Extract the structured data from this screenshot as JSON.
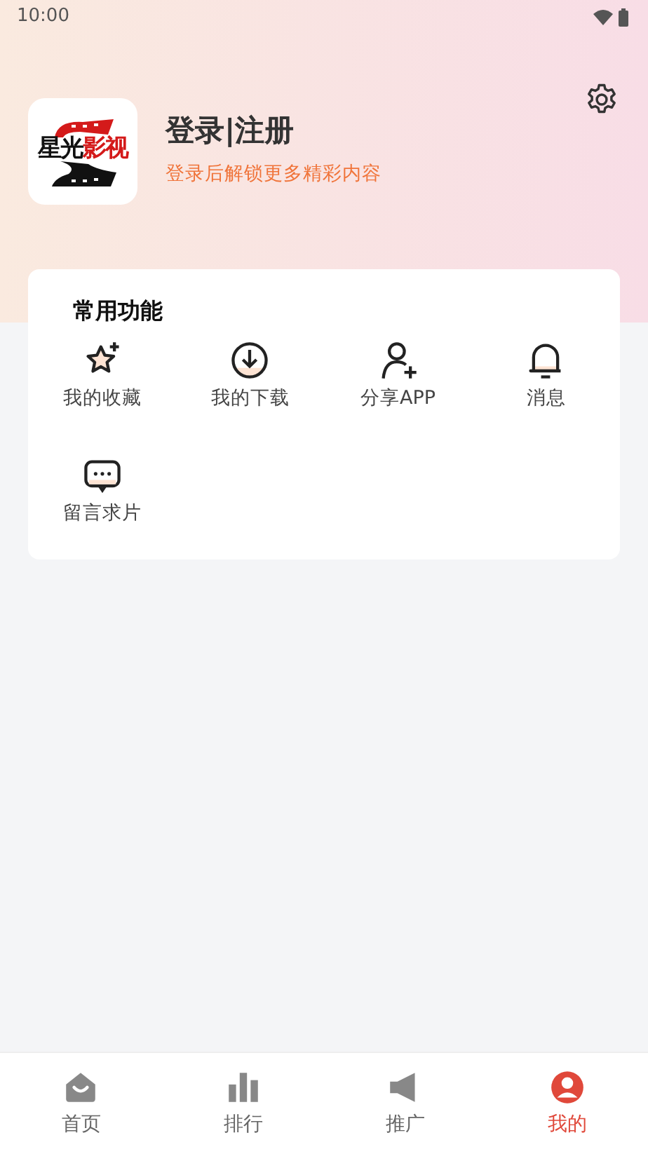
{
  "status_bar": {
    "time": "10:00"
  },
  "profile": {
    "logo": {
      "text_dark": "星光",
      "text_red": "影视"
    },
    "title": "登录|注册",
    "subtitle": "登录后解锁更多精彩内容"
  },
  "features": {
    "title": "常用功能",
    "items": [
      {
        "label": "我的收藏"
      },
      {
        "label": "我的下载"
      },
      {
        "label": "分享APP"
      },
      {
        "label": "消息"
      },
      {
        "label": "留言求片"
      }
    ]
  },
  "bottom_nav": [
    {
      "label": "首页",
      "selected": false
    },
    {
      "label": "排行",
      "selected": false
    },
    {
      "label": "推广",
      "selected": false
    },
    {
      "label": "我的",
      "selected": true
    }
  ]
}
